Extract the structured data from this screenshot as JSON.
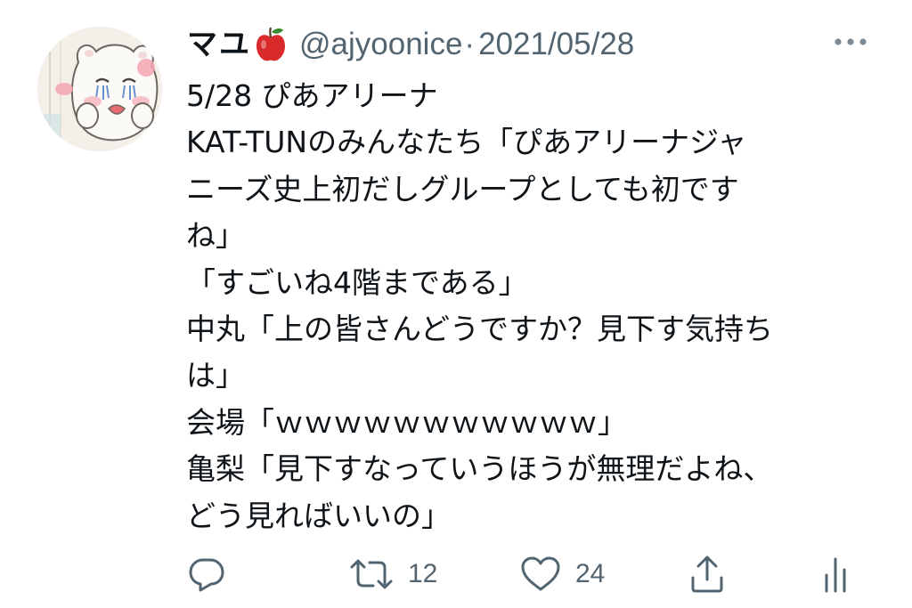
{
  "tweet": {
    "display_name": "マユ",
    "name_emoji": "apple-emoji",
    "handle": "@ajyoonice",
    "separator": "·",
    "date": "2021/05/28",
    "more_icon": "more-horizontal-icon",
    "lines": [
      "5/28 ぴあアリーナ",
      "KAT-TUNのみんなたち「ぴあアリーナジャ",
      "ニーズ史上初だしグループとしても初です",
      "ね」",
      "「すごいね4階まである」",
      "中丸「上の皆さんどうですか？見下す気持ち",
      "は」",
      "会場「ｗｗｗｗｗｗｗｗｗｗｗ」",
      "亀梨「見下すなっていうほうが無理だよね、",
      "どう見ればいいの」"
    ]
  },
  "actions": {
    "reply": {
      "icon": "reply-icon"
    },
    "retweet": {
      "icon": "retweet-icon",
      "count": "12"
    },
    "like": {
      "icon": "heart-icon",
      "count": "24"
    },
    "share": {
      "icon": "share-icon"
    },
    "analytics": {
      "icon": "analytics-icon"
    }
  },
  "colors": {
    "text": "#0f1419",
    "secondary": "#536471",
    "apple_red": "#d92b2b",
    "apple_leaf": "#3b8a2e",
    "background": "#ffffff"
  }
}
